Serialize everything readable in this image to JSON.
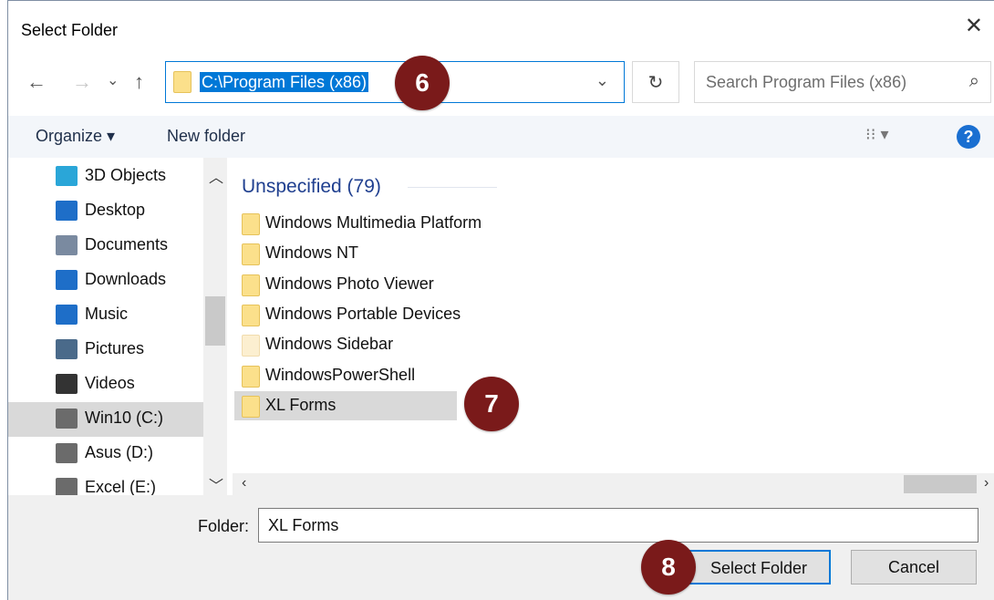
{
  "dialog": {
    "title": "Select Folder",
    "close": "✕"
  },
  "nav_buttons": {
    "back": "←",
    "forward": "→",
    "recent": "⌄",
    "up": "↑"
  },
  "address": {
    "path": "C:\\Program Files (x86)",
    "dropdown": "⌄"
  },
  "refresh": "↻",
  "search": {
    "placeholder": "Search Program Files (x86)",
    "icon": "⌕"
  },
  "toolbar": {
    "organize": "Organize ▾",
    "new_folder": "New folder",
    "view": "⁝⁝ ▾",
    "help": "?"
  },
  "sidebar": {
    "items": [
      {
        "label": "3D Objects",
        "icon": "cube-icon",
        "color": "#2aa6d8"
      },
      {
        "label": "Desktop",
        "icon": "desktop-icon",
        "color": "#1e6ec8"
      },
      {
        "label": "Documents",
        "icon": "document-icon",
        "color": "#7a8aa0"
      },
      {
        "label": "Downloads",
        "icon": "download-arrow-icon",
        "color": "#1e6ec8"
      },
      {
        "label": "Music",
        "icon": "music-note-icon",
        "color": "#1e6ec8"
      },
      {
        "label": "Pictures",
        "icon": "pictures-icon",
        "color": "#4a6a8a"
      },
      {
        "label": "Videos",
        "icon": "film-icon",
        "color": "#333333"
      },
      {
        "label": "Win10 (C:)",
        "icon": "drive-windows-icon",
        "color": "#6b6b6b",
        "selected": true
      },
      {
        "label": "Asus (D:)",
        "icon": "drive-icon",
        "color": "#6b6b6b"
      },
      {
        "label": "Excel (E:)",
        "icon": "drive-icon",
        "color": "#6b6b6b"
      }
    ]
  },
  "content": {
    "group": "Unspecified (79)",
    "files": [
      {
        "name": "Windows Multimedia Platform"
      },
      {
        "name": "Windows NT"
      },
      {
        "name": "Windows Photo Viewer"
      },
      {
        "name": "Windows Portable Devices"
      },
      {
        "name": "Windows Sidebar",
        "faint": true
      },
      {
        "name": "WindowsPowerShell"
      },
      {
        "name": "XL Forms",
        "selected": true
      }
    ]
  },
  "footer": {
    "folder_label": "Folder:",
    "folder_value": "XL Forms",
    "select_button": "Select Folder",
    "cancel_button": "Cancel"
  },
  "callouts": {
    "address": "6",
    "file": "7",
    "select": "8"
  }
}
